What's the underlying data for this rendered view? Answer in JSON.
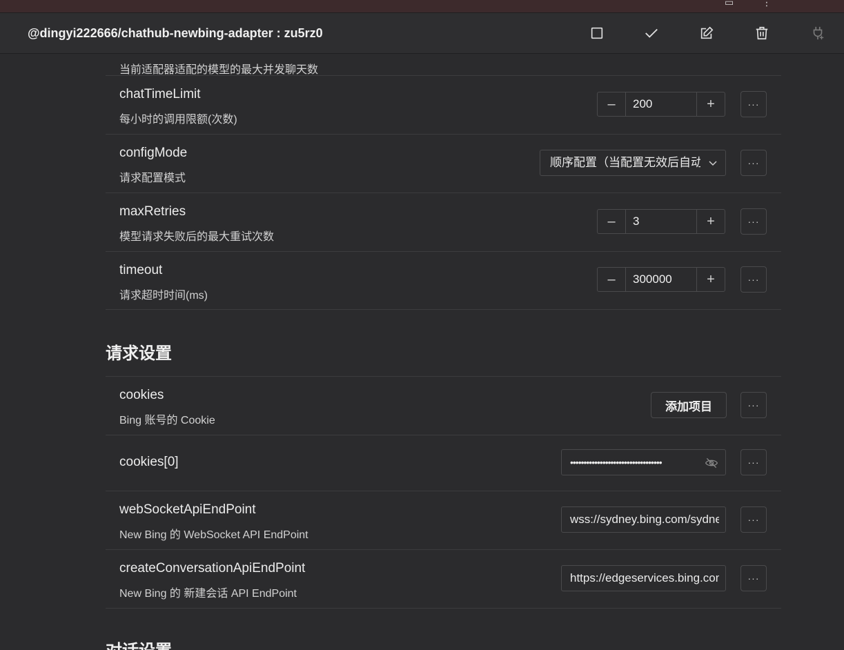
{
  "header": {
    "title": "@dingyi222666/chathub-newbing-adapter : zu5rz0"
  },
  "icons": {
    "checkbox": "square-icon",
    "apply": "check-icon",
    "edit": "edit-icon",
    "delete": "trash-icon",
    "plugin": "plug-icon"
  },
  "rows": [
    {
      "name": "",
      "desc": "当前适配器适配的模型的最大并发聊天数"
    },
    {
      "name": "chatTimeLimit",
      "desc": "每小时的调用限额(次数)",
      "value": "200"
    },
    {
      "name": "configMode",
      "desc": "请求配置模式",
      "value": "顺序配置（当配置无效后自动切换）"
    },
    {
      "name": "maxRetries",
      "desc": "模型请求失败后的最大重试次数",
      "value": "3"
    },
    {
      "name": "timeout",
      "desc": "请求超时时间(ms)",
      "value": "300000"
    }
  ],
  "section2": {
    "title": "请求设置",
    "cookies": {
      "name": "cookies",
      "desc": "Bing 账号的 Cookie",
      "add_label": "添加项目"
    },
    "cookie0": {
      "name": "cookies[0]",
      "value": "••••••••••••••••••••••••••••••••••"
    },
    "ws": {
      "name": "webSocketApiEndPoint",
      "desc": "New Bing 的 WebSocket API EndPoint",
      "value": "wss://sydney.bing.com/sydney/ChatHub"
    },
    "conv": {
      "name": "createConversationApiEndPoint",
      "desc": "New Bing 的 新建会话 API EndPoint",
      "value": "https://edgeservices.bing.com/edgesvc/turing/conversation/create"
    }
  },
  "section3": {
    "title": "对话设置"
  },
  "more_label": "···",
  "minus_label": "–",
  "plus_label": "+"
}
